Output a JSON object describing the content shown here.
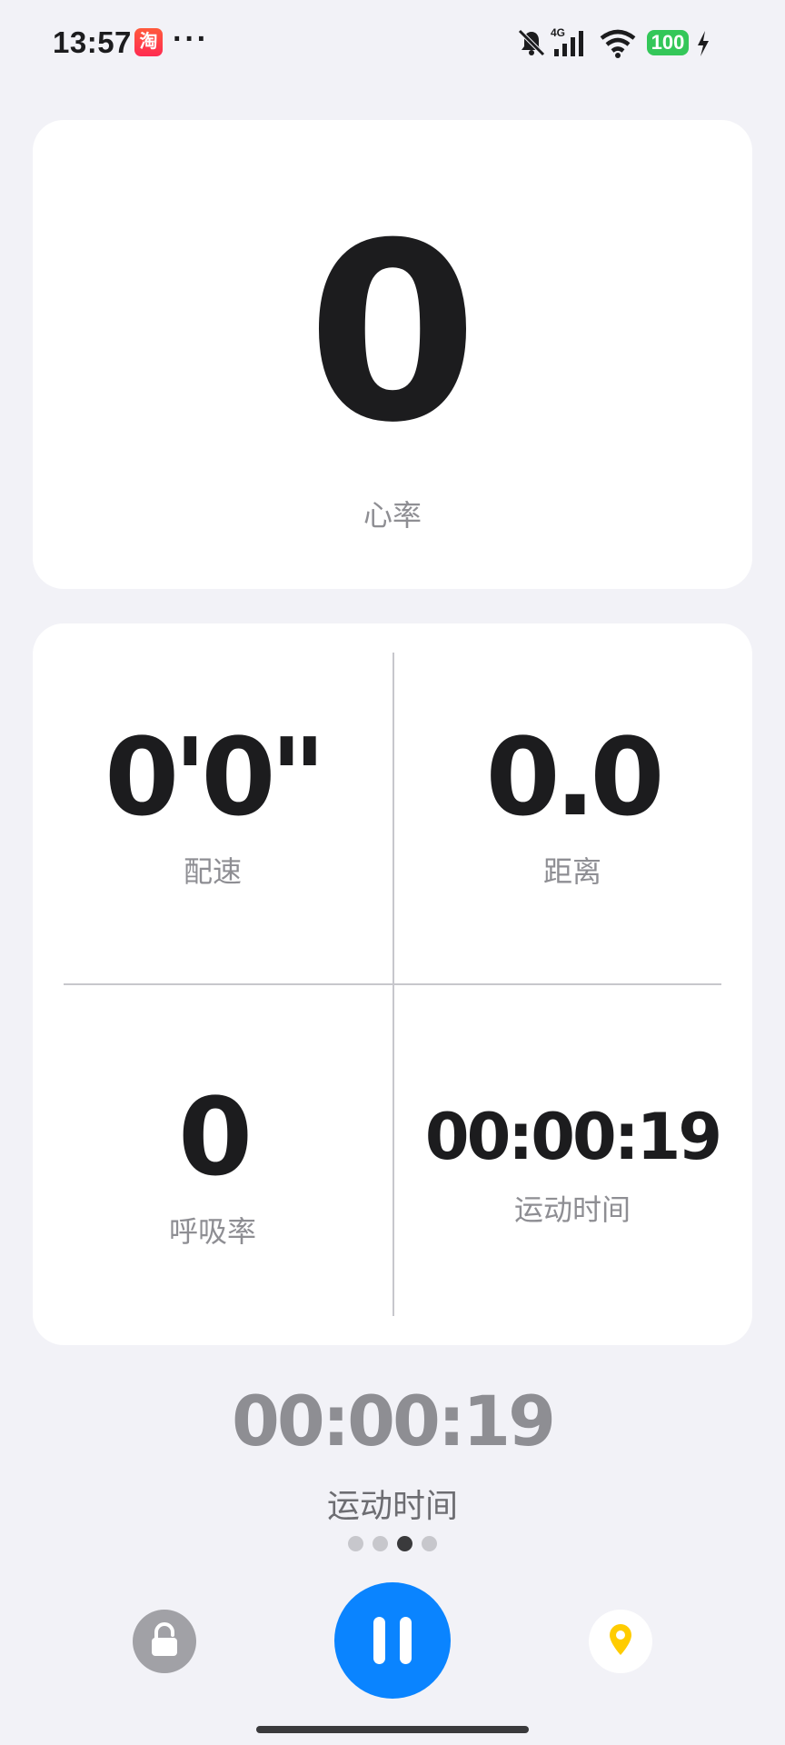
{
  "status_bar": {
    "time": "13:57",
    "app_icon_text": "淘",
    "more": "···",
    "network": "4G",
    "battery": "100"
  },
  "heart_rate": {
    "value": "0",
    "label": "心率"
  },
  "metrics": [
    {
      "value": "0'0\"",
      "label": "配速"
    },
    {
      "value": "0.0",
      "label": "距离"
    },
    {
      "value": "0",
      "label": "呼吸率"
    },
    {
      "value": "00:00:19",
      "label": "运动时间"
    }
  ],
  "summary": {
    "value": "00:00:19",
    "label": "运动时间"
  },
  "pager": {
    "count": 4,
    "active_index": 2
  },
  "controls": {
    "lock": "lock-icon",
    "pause": "pause-icon",
    "location": "location-pin-icon"
  },
  "colors": {
    "accent": "#0a84ff",
    "background": "#f2f2f7",
    "battery": "#34c759",
    "location_pin": "#ffcc00"
  }
}
